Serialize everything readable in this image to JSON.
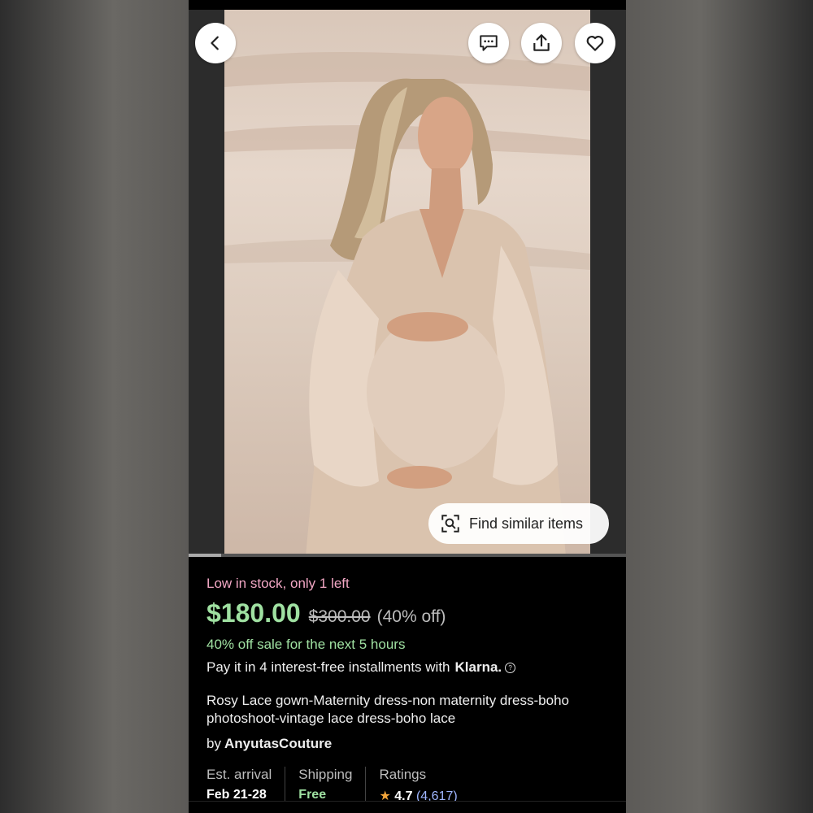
{
  "product": {
    "stock_notice": "Low in stock, only 1 left",
    "price": "$180.00",
    "original_price": "$300.00",
    "discount": "(40% off)",
    "sale_notice": "40% off sale for the next 5 hours",
    "installments_text": "Pay it in 4 interest-free installments with",
    "installments_provider": "Klarna.",
    "title": "Rosy Lace gown-Maternity dress-non maternity dress-boho photoshoot-vintage lace dress-boho lace",
    "seller_prefix": "by",
    "seller_name": "AnyutasCouture"
  },
  "image_overlay": {
    "find_similar_label": "Find similar items"
  },
  "stats": {
    "arrival_label": "Est. arrival",
    "arrival_value": "Feb 21-28",
    "shipping_label": "Shipping",
    "shipping_value": "Free",
    "ratings_label": "Ratings",
    "ratings_value": "4.7",
    "ratings_count": "(4,617)"
  },
  "icons": {
    "back": "chevron-left-icon",
    "message": "message-icon",
    "share": "share-icon",
    "favorite": "heart-icon",
    "visual_search": "visual-search-icon",
    "help": "help-icon",
    "rating_star": "star-icon"
  },
  "colors": {
    "price_green": "#9fe0a1",
    "stock_pink": "#f2a7c4",
    "link_blue": "#9fb6ff",
    "star_orange": "#f3a53a"
  }
}
